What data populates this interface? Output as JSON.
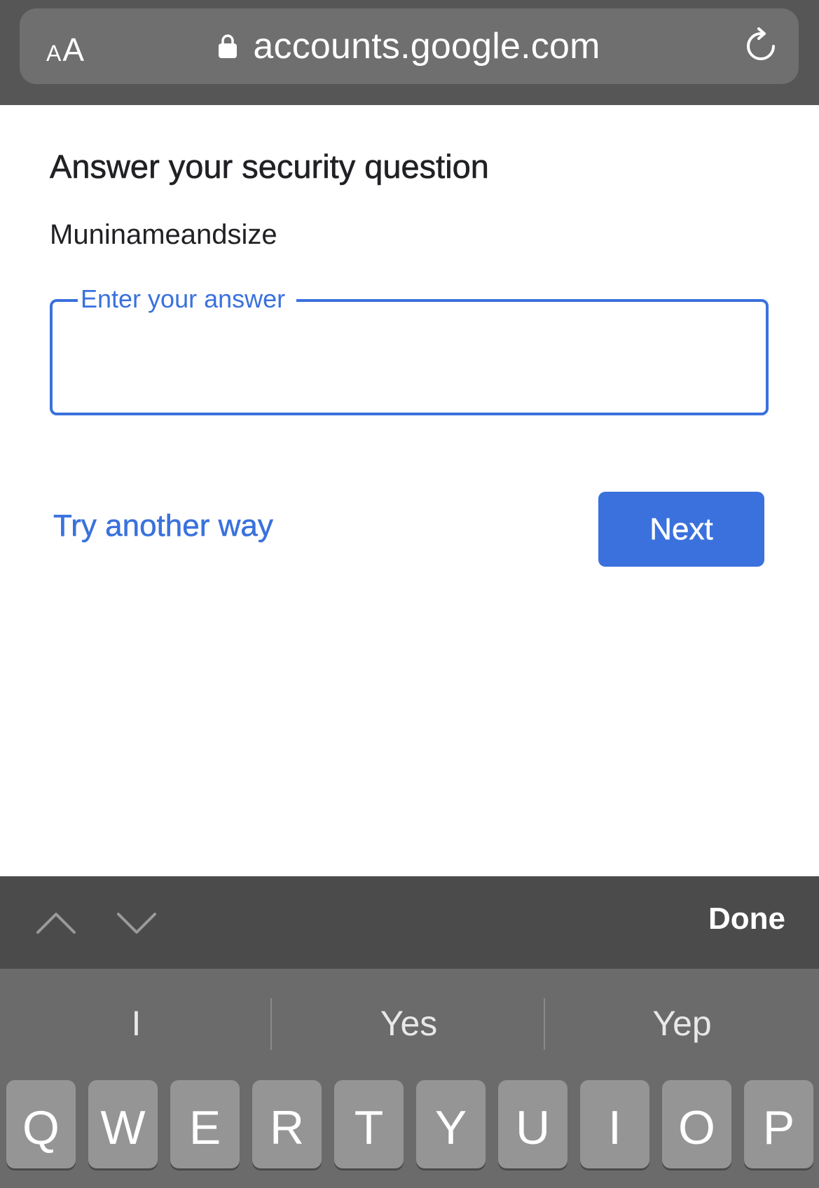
{
  "browser": {
    "text_size_small": "A",
    "text_size_large": "A",
    "url": "accounts.google.com"
  },
  "page": {
    "title": "Answer your security question",
    "question": "Muninameandsize",
    "answer_label": "Enter your answer",
    "answer_value": "",
    "try_another_way": "Try another way",
    "next_label": "Next"
  },
  "accessory": {
    "done_label": "Done"
  },
  "keyboard": {
    "suggestions": [
      "I",
      "Yes",
      "Yep"
    ],
    "keys": [
      "Q",
      "W",
      "E",
      "R",
      "T",
      "Y",
      "U",
      "I",
      "O",
      "P"
    ]
  },
  "colors": {
    "accent": "#3a71dd",
    "browser_bar": "#565656",
    "keyboard_bg": "#6b6b6b",
    "key_bg": "#959595"
  }
}
